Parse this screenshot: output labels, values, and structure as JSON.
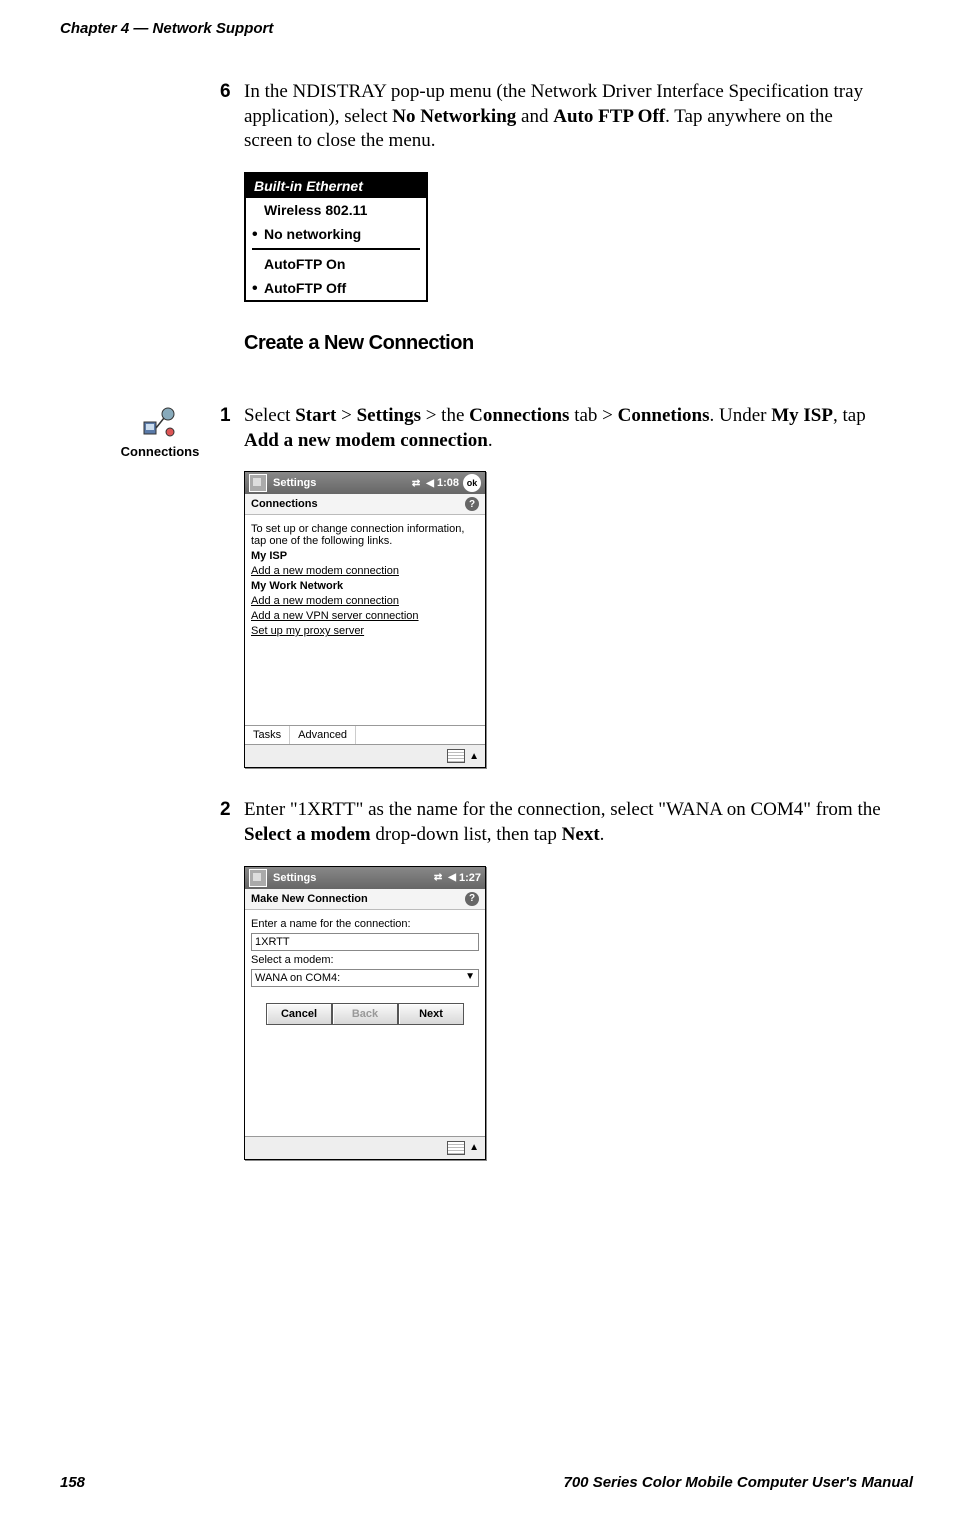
{
  "header": {
    "chapter": "Chapter 4",
    "dash": " — ",
    "title": "Network Support"
  },
  "step6": {
    "num": "6",
    "p1a": "In the NDISTRAY pop-up menu (the Network Driver Interface Specification tray application), select ",
    "no_net": "No Networking",
    "and": " and ",
    "auto_off": "Auto FTP Off",
    "p1b": ". Tap anywhere on the screen to close the menu."
  },
  "ndistray": {
    "title": "Built-in Ethernet",
    "i1": "Wireless 802.11",
    "i2": "No networking",
    "i3": "AutoFTP On",
    "i4": "AutoFTP Off"
  },
  "heading": "Create a New Connection",
  "sideicon_label": "Connections",
  "step1": {
    "num": "1",
    "a": "Select ",
    "start": "Start",
    "gt1": " > ",
    "settings": "Settings",
    "gt2": " > the ",
    "conn_tab": "Connections",
    "gt3": " tab > ",
    "conn": "Connetions",
    "b": ". Under ",
    "myisp": "My ISP",
    "c": ", tap ",
    "addmodem": "Add a new modem connection",
    "d": "."
  },
  "ppc1": {
    "topbar_title": "Settings",
    "time": "1:08",
    "ok": "ok",
    "title": "Connections",
    "desc": "To set up or change connection information, tap one of the following links.",
    "myisp": "My ISP",
    "l1": "Add a new modem connection",
    "mywork": "My Work Network",
    "l2": "Add a new modem connection",
    "l3": "Add a new VPN server connection",
    "l4": "Set up my proxy server",
    "tab1": "Tasks",
    "tab2": "Advanced"
  },
  "step2": {
    "num": "2",
    "a": "Enter \"1XRTT\" as the name for the connection, select \"WANA on COM4\" from the ",
    "selmodem": "Select a modem",
    "b": " drop-down list, then tap ",
    "next": "Next",
    "c": "."
  },
  "ppc2": {
    "topbar_title": "Settings",
    "time": "1:27",
    "title": "Make New Connection",
    "lbl_name": "Enter a name for the connection:",
    "name_val": "1XRTT",
    "lbl_modem": "Select a modem:",
    "modem_val": "WANA on COM4:",
    "btn_cancel": "Cancel",
    "btn_back": "Back",
    "btn_next": "Next"
  },
  "footer": {
    "page": "158",
    "manual": "700 Series Color Mobile Computer User's Manual"
  }
}
